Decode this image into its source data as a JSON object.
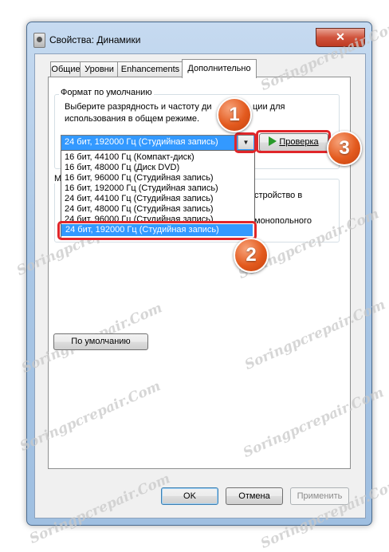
{
  "window": {
    "title": "Свойства: Динамики",
    "close_label": "✕"
  },
  "tabs": [
    {
      "label": "Общие"
    },
    {
      "label": "Уровни"
    },
    {
      "label": "Enhancements"
    },
    {
      "label": "Дополнительно"
    }
  ],
  "default_format": {
    "group_title": "Формат по умолчанию",
    "description_line1": "Выберите разрядность и частоту ди",
    "description_line1_tail": "ции для",
    "description_line2": "использования в общем режиме.",
    "selected_value": "24 бит, 192000 Гц (Студийная запись)",
    "options": [
      "16 бит, 44100 Гц (Компакт-диск)",
      "16 бит, 48000 Гц (Диск DVD)",
      "16 бит, 96000 Гц (Студийная запись)",
      "16 бит, 192000 Гц (Студийная запись)",
      "24 бит, 44100 Гц (Студийная запись)",
      "24 бит, 48000 Гц (Студийная запись)",
      "24 бит, 96000 Гц (Студийная запись)",
      "24 бит, 192000 Гц (Студийная запись)"
    ],
    "test_button_label": "Проверка"
  },
  "exclusive_mode": {
    "group_title": "М",
    "text_tail1": "стройство в",
    "text_tail2": "монопольного"
  },
  "default_button_label": "По умолчанию",
  "footer": {
    "ok_label": "OK",
    "cancel_label": "Отмена",
    "apply_label": "Применить"
  },
  "badges": {
    "one": "1",
    "two": "2",
    "three": "3"
  },
  "watermark": "Soringpcrepair.Com",
  "colors": {
    "selection": "#3399ff",
    "marker": "#e0262a",
    "badge": "#e35a1e"
  }
}
